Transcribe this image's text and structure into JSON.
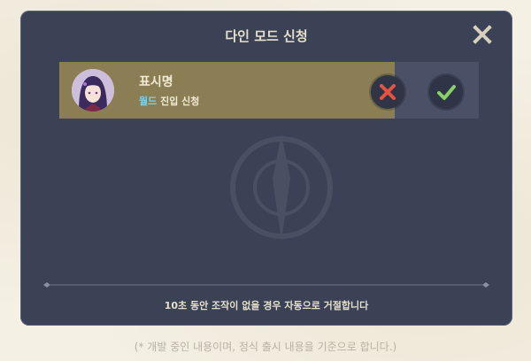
{
  "dialog": {
    "title": "다인 모드 신청",
    "notice": "10초 동안 조작이 없을 경우 자동으로 거절합니다"
  },
  "request": {
    "display_name": "표시명",
    "world_label": "월드",
    "request_text": "진입 신청",
    "timer_remaining_fraction": 0.8
  },
  "footnote": "(* 개발 중인 내용이며, 정식 출시 내용을 기준으로 합니다.)",
  "icons": {
    "close": "close-icon",
    "decline": "x-icon",
    "accept": "check-icon"
  },
  "colors": {
    "dialog_bg": "#3b4255",
    "row_fill": "#8b7e55",
    "decline": "#e8533f",
    "accept": "#88d06a",
    "world": "#6fd6f4"
  }
}
